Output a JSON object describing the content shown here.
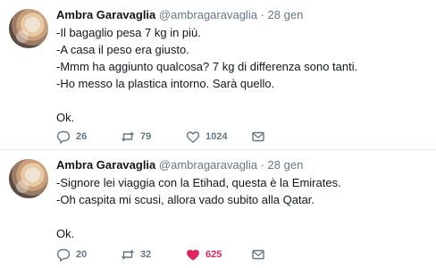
{
  "tweets": [
    {
      "author": "Ambra Garavaglia",
      "handle": "@ambragaravaglia",
      "separator": "·",
      "date": "28 gen",
      "lines": [
        "-Il bagaglio pesa 7 kg in più.",
        "-A casa il peso era giusto.",
        "-Mmm ha aggiunto qualcosa? 7 kg di differenza sono tanti.",
        "-Ho messo la plastica intorno. Sarà quello.",
        "",
        "Ok."
      ],
      "replies": "26",
      "retweets": "79",
      "likes": "1024",
      "liked": false,
      "icons": {
        "reply": "reply-icon",
        "retweet": "retweet-icon",
        "like": "heart-outline-icon",
        "dm": "envelope-icon"
      }
    },
    {
      "author": "Ambra Garavaglia",
      "handle": "@ambragaravaglia",
      "separator": "·",
      "date": "28 gen",
      "lines": [
        "-Signore lei viaggia con la Etihad, questa è la Emirates.",
        "-Oh caspita mi scusi, allora vado subito alla Qatar.",
        "",
        "Ok."
      ],
      "replies": "20",
      "retweets": "32",
      "likes": "625",
      "liked": true,
      "icons": {
        "reply": "reply-icon",
        "retweet": "retweet-icon",
        "like": "heart-filled-icon",
        "dm": "envelope-icon"
      }
    }
  ],
  "colors": {
    "text": "#14171a",
    "muted": "#657786",
    "like_active": "#e0245e",
    "divider": "#e6ecf0"
  }
}
